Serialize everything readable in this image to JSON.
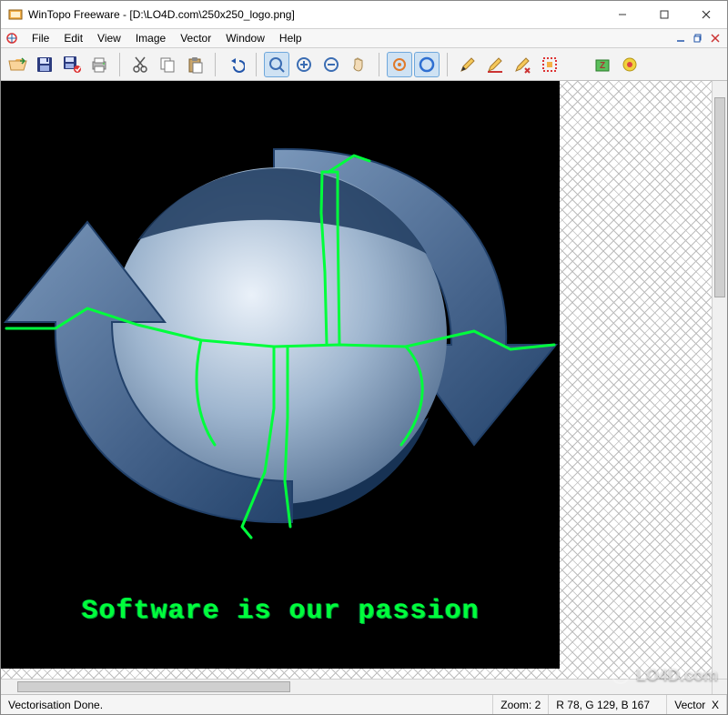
{
  "title": "WinTopo Freeware - [D:\\LO4D.com\\250x250_logo.png]",
  "menu": {
    "items": [
      "File",
      "Edit",
      "View",
      "Image",
      "Vector",
      "Window",
      "Help"
    ]
  },
  "toolbar": {
    "icons": {
      "open": "open-folder-icon",
      "save": "save-icon",
      "save_as": "save-as-icon",
      "print": "print-icon",
      "cut": "cut-icon",
      "copy": "copy-icon",
      "paste": "paste-icon",
      "undo": "undo-icon",
      "zoom_area": "zoom-area-icon",
      "zoom_in": "zoom-in-icon",
      "zoom_out": "zoom-out-icon",
      "pan": "pan-icon",
      "vector_show": "vector-show-icon",
      "vector_toggle": "vector-toggle-icon",
      "pencil": "pencil-icon",
      "edit_vector": "edit-vector-icon",
      "tidy_vector": "tidy-vector-icon",
      "select_area": "select-area-icon",
      "plugin_a": "plugin-a-icon",
      "plugin_b": "plugin-b-icon"
    }
  },
  "canvas": {
    "caption": "Software is our passion",
    "colors": {
      "trace": "#00ff3c",
      "arrow_body": "#5f7fa3",
      "arrow_edge": "#2d4d73",
      "sphere_light": "#d6e2ef",
      "sphere_mid": "#93aac7",
      "sphere_dark": "#1f3b5e"
    }
  },
  "status": {
    "message": "Vectorisation Done.",
    "zoom_label": "Zoom:",
    "zoom_value": "2",
    "rgb": "R 78, G 129, B 167",
    "vector_label": "Vector",
    "vector_coord": "X"
  },
  "watermark": "LO4D.com"
}
